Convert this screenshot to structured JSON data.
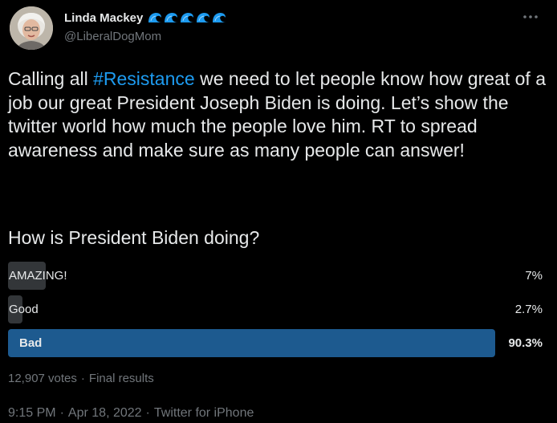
{
  "author": {
    "display_name": "Linda Mackey",
    "handle": "@LiberalDogMom",
    "badge_icons": [
      "wave-icon",
      "wave-icon",
      "wave-icon",
      "wave-icon",
      "wave-icon"
    ]
  },
  "tweet": {
    "text_hashtag": "#Resistance",
    "text_before": "Calling all ",
    "text_after": " we need to let people know how great of a job our great President Joseph Biden is doing. Let’s show the twitter world how much the people love him. RT to spread awareness and make sure as many people can answer!",
    "question": "How is President Biden doing?"
  },
  "poll": {
    "options": [
      {
        "label": "AMAZING!",
        "percent": "7%",
        "fraction": 0.07,
        "winner": false
      },
      {
        "label": "Good",
        "percent": "2.7%",
        "fraction": 0.027,
        "winner": false
      },
      {
        "label": "Bad",
        "percent": "90.3%",
        "fraction": 0.903,
        "winner": true
      }
    ],
    "votes": "12,907 votes",
    "status": "Final results",
    "separator": "·"
  },
  "meta": {
    "time": "9:15 PM",
    "date": "Apr 18, 2022",
    "source": "Twitter for iPhone",
    "separator": "·"
  },
  "colors": {
    "background": "#000000",
    "text": "#e7e9ea",
    "muted": "#71767b",
    "link": "#1d9bf0",
    "bar": "#333639",
    "bar_winner": "#1d5a8f"
  }
}
